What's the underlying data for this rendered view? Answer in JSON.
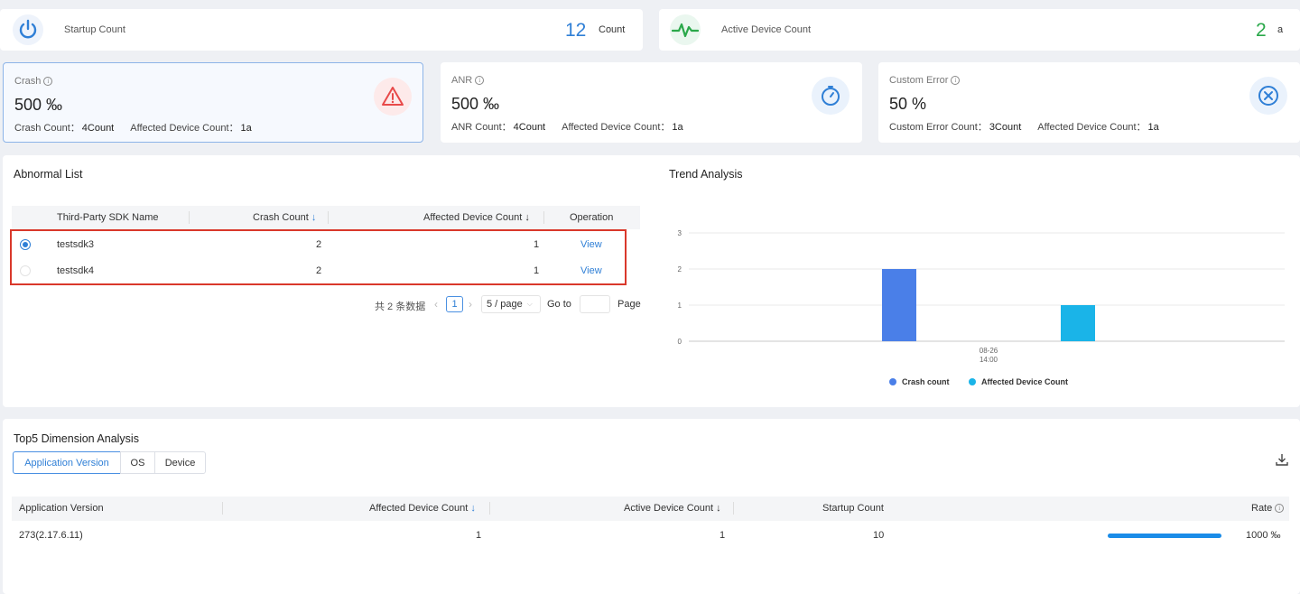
{
  "top_stats": {
    "startup": {
      "label": "Startup Count",
      "value": "12",
      "unit": "Count",
      "icon": "power-icon"
    },
    "active": {
      "label": "Active Device Count",
      "value": "2",
      "unit": "a",
      "icon": "pulse-icon"
    }
  },
  "metrics": [
    {
      "key": "crash",
      "title": "Crash",
      "value": "500 ‰",
      "count_label": "Crash Count：",
      "count_value": "4Count",
      "affected_label": "Affected Device Count：",
      "affected_value": "1a",
      "icon": "warning-icon",
      "color": "#e84a4a"
    },
    {
      "key": "anr",
      "title": "ANR",
      "value": "500 ‰",
      "count_label": "ANR Count：",
      "count_value": "4Count",
      "affected_label": "Affected Device Count：",
      "affected_value": "1a",
      "icon": "stopwatch-icon",
      "color": "#2f7fd6"
    },
    {
      "key": "custom",
      "title": "Custom Error",
      "value": "50 %",
      "count_label": "Custom Error Count：",
      "count_value": "3Count",
      "affected_label": "Affected Device Count：",
      "affected_value": "1a",
      "icon": "close-circle-icon",
      "color": "#2f7fd6"
    }
  ],
  "abnormal": {
    "title": "Abnormal List",
    "headers": {
      "name": "Third-Party SDK Name",
      "crash": "Crash Count",
      "affected": "Affected Device Count",
      "op": "Operation"
    },
    "rows": [
      {
        "name": "testsdk3",
        "crash": "2",
        "affected": "1",
        "op": "View",
        "selected": true
      },
      {
        "name": "testsdk4",
        "crash": "2",
        "affected": "1",
        "op": "View",
        "selected": false
      }
    ],
    "pagination": {
      "total": "共 2 条数据",
      "page": "1",
      "page_size": "5 / page",
      "goto": "Go to",
      "page_label": "Page"
    }
  },
  "trend": {
    "title": "Trend Analysis",
    "chart_data": {
      "type": "bar",
      "categories": [
        "08-26 14:00"
      ],
      "series": [
        {
          "name": "Crash count",
          "values": [
            2
          ],
          "color": "#4a7fe8"
        },
        {
          "name": "Affected Device Count",
          "values": [
            1
          ],
          "color": "#1ab4e8"
        }
      ],
      "ylim": [
        0,
        3
      ],
      "yticks": [
        "0",
        "1",
        "2",
        "3"
      ],
      "xtick_line1": "08-26",
      "xtick_line2": "14:00",
      "legend_position": "bottom"
    }
  },
  "top5": {
    "title": "Top5 Dimension Analysis",
    "tabs": [
      "Application Version",
      "OS",
      "Device"
    ],
    "active_tab": 0,
    "headers": {
      "version": "Application Version",
      "affected": "Affected Device Count",
      "active": "Active Device Count",
      "startup": "Startup Count",
      "rate": "Rate"
    },
    "rows": [
      {
        "version": "273(2.17.6.11)",
        "affected": "1",
        "active": "1",
        "startup": "10",
        "rate": "1000 ‰",
        "rate_fraction": 1.0
      }
    ]
  }
}
